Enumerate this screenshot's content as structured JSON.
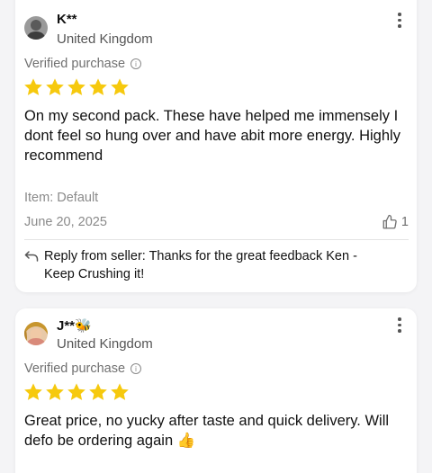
{
  "colors": {
    "star": "#f6c90e",
    "muted": "#8a8a8a",
    "text": "#111111",
    "background": "#f4f4f6"
  },
  "reviews": [
    {
      "name": "K**",
      "country": "United Kingdom",
      "verified": "Verified purchase",
      "rating": 5,
      "text": "On my second pack. These have helped me immensely I dont feel so hung over and have abit more energy. Highly recommend",
      "item": "Item: Default",
      "date": "June 20, 2025",
      "helpful_count": "1",
      "reply": "Reply from seller: Thanks for the great feedback Ken - Keep Crushing it!",
      "avatar_icon": "user-avatar-photo",
      "more_icon": "more-vertical-icon",
      "helpful_icon": "thumbs-up-icon",
      "reply_icon": "reply-arrow-icon"
    },
    {
      "name": "J**🐝",
      "country": "United Kingdom",
      "verified": "Verified purchase",
      "rating": 5,
      "text": "Great price, no yucky after taste and quick delivery. Will defo be ordering again 👍",
      "avatar_icon": "user-avatar-photo",
      "more_icon": "more-vertical-icon"
    }
  ]
}
